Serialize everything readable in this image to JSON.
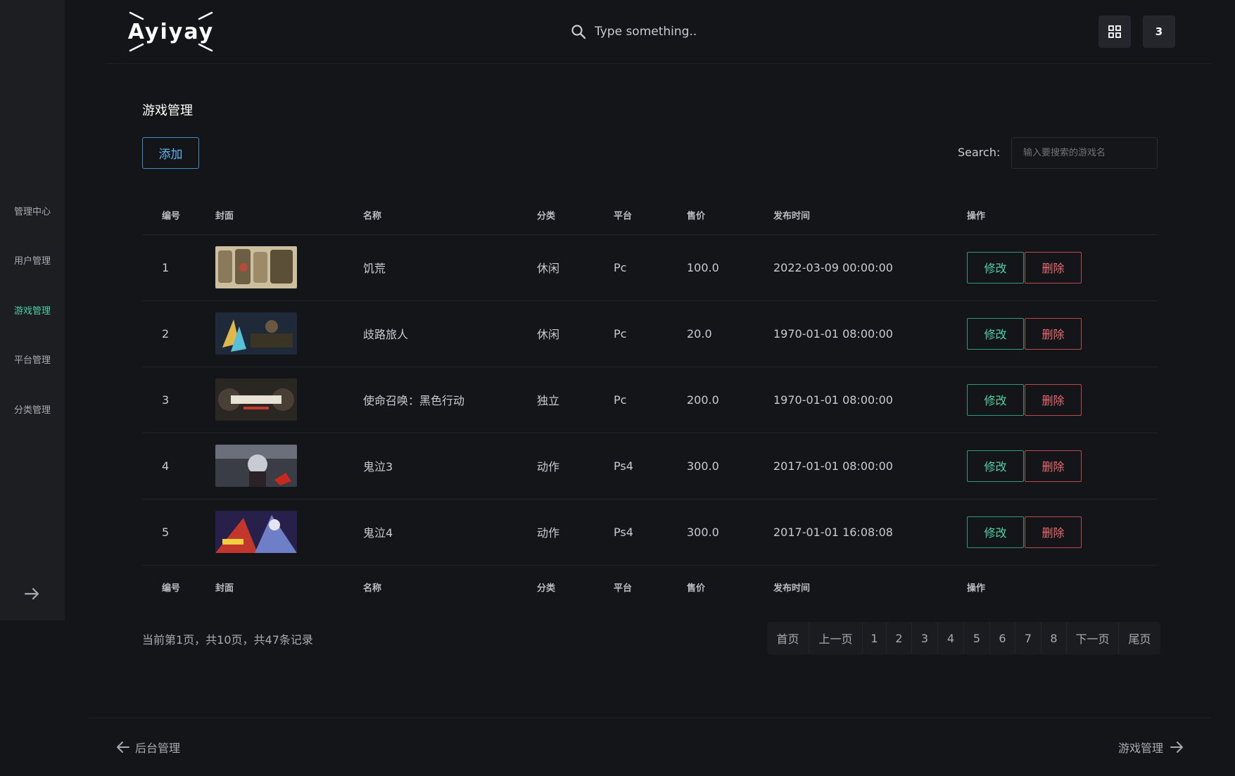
{
  "brand": {
    "name": "Ayiyay"
  },
  "sidebar": {
    "items": [
      {
        "label": "管理中心",
        "active": false
      },
      {
        "label": "用户管理",
        "active": false
      },
      {
        "label": "游戏管理",
        "active": true
      },
      {
        "label": "平台管理",
        "active": false
      },
      {
        "label": "分类管理",
        "active": false
      }
    ],
    "collapse_icon": "arrow-right-icon"
  },
  "header": {
    "search_placeholder": "Type something..",
    "grid_icon": "grid-icon",
    "badge_count": "3"
  },
  "page": {
    "title": "游戏管理",
    "add_label": "添加",
    "search_label": "Search:",
    "search_placeholder": "输入要搜索的游戏名"
  },
  "table": {
    "columns": [
      "编号",
      "封面",
      "名称",
      "分类",
      "平台",
      "售价",
      "发布时间",
      "操作"
    ],
    "rows": [
      {
        "id": "1",
        "cover": "cover-image-1",
        "name": "饥荒",
        "category": "休闲",
        "platform": "Pc",
        "price": "100.0",
        "release": "2022-03-09 00:00:00"
      },
      {
        "id": "2",
        "cover": "cover-image-2",
        "name": "歧路旅人",
        "category": "休闲",
        "platform": "Pc",
        "price": "20.0",
        "release": "1970-01-01 08:00:00"
      },
      {
        "id": "3",
        "cover": "cover-image-3",
        "name": "使命召唤：黑色行动",
        "category": "独立",
        "platform": "Pc",
        "price": "200.0",
        "release": "1970-01-01 08:00:00"
      },
      {
        "id": "4",
        "cover": "cover-image-4",
        "name": "鬼泣3",
        "category": "动作",
        "platform": "Ps4",
        "price": "300.0",
        "release": "2017-01-01 08:00:00"
      },
      {
        "id": "5",
        "cover": "cover-image-5",
        "name": "鬼泣4",
        "category": "动作",
        "platform": "Ps4",
        "price": "300.0",
        "release": "2017-01-01 16:08:08"
      }
    ],
    "edit_label": "修改",
    "delete_label": "删除"
  },
  "pagination": {
    "info": "当前第1页，共10页，共47条记录",
    "first": "首页",
    "prev": "上一页",
    "pages": [
      "1",
      "2",
      "3",
      "4",
      "5",
      "6",
      "7",
      "8"
    ],
    "next": "下一页",
    "last": "尾页"
  },
  "footer": {
    "prev_label": "后台管理",
    "next_label": "游戏管理"
  },
  "colors": {
    "background": "#141518",
    "sidebar": "#1d1e22",
    "accent_green": "#4fd1a5",
    "accent_blue": "#5cb4ee",
    "danger_red": "#ea6a72"
  }
}
